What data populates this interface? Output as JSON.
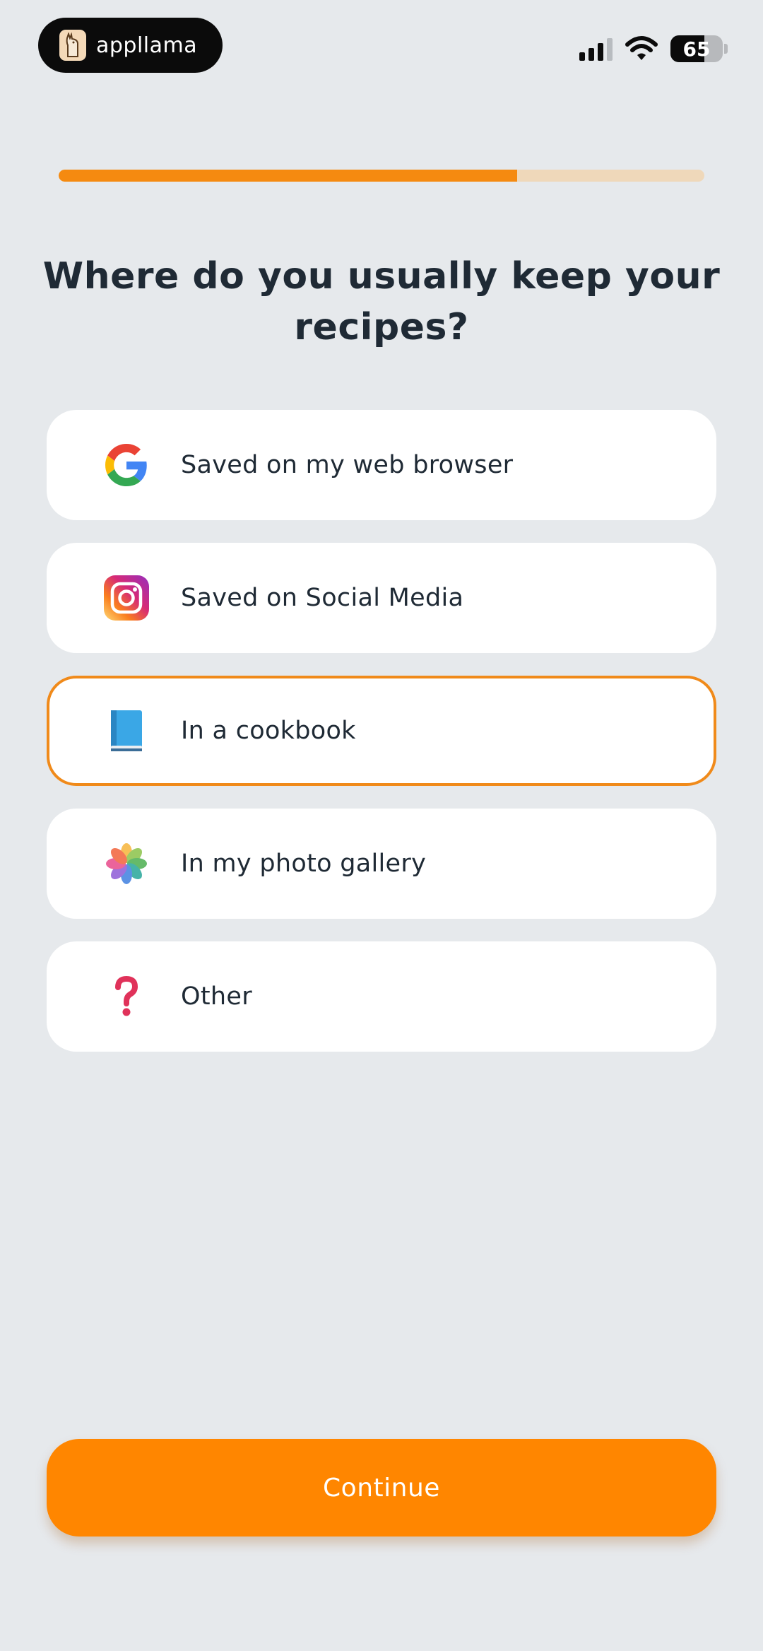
{
  "status_bar": {
    "brand": "appllama",
    "brand_icon": "llama-icon",
    "battery_percent": "65",
    "battery_level": 0.65
  },
  "progress": {
    "fraction": 0.71,
    "fill_color": "#f58a10",
    "track_color": "#efd8ba"
  },
  "question": "Where do you usually keep your recipes?",
  "options": [
    {
      "label": "Saved on my web browser",
      "icon": "google-icon",
      "selected": false
    },
    {
      "label": "Saved on Social Media",
      "icon": "instagram-icon",
      "selected": false
    },
    {
      "label": "In a cookbook",
      "icon": "book-icon",
      "selected": true
    },
    {
      "label": "In my photo gallery",
      "icon": "photos-icon",
      "selected": false
    },
    {
      "label": "Other",
      "icon": "question-mark-icon",
      "selected": false
    }
  ],
  "continue_label": "Continue",
  "colors": {
    "accent": "#ff8600",
    "background": "#e6e9ec",
    "text": "#1f2a35"
  }
}
